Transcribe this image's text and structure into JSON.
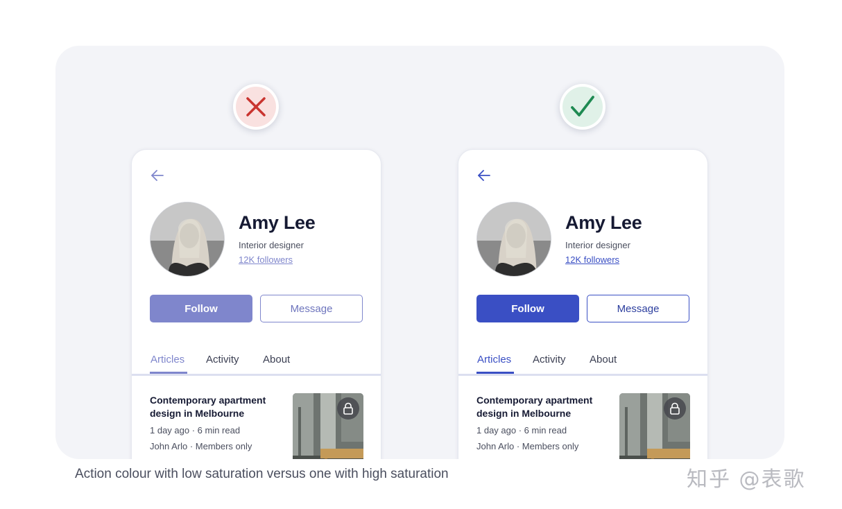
{
  "caption": "Action colour with low saturation versus one with high saturation",
  "watermark": "知乎 @表歌",
  "examples": [
    {
      "verdict": "incorrect",
      "verdict_icon": "x-icon",
      "accent": "#7f86cc",
      "profile": {
        "name": "Amy Lee",
        "role": "Interior designer",
        "followers": "12K followers"
      },
      "buttons": {
        "follow": "Follow",
        "message": "Message"
      },
      "tabs": [
        "Articles",
        "Activity",
        "About"
      ],
      "active_tab": "Articles",
      "article": {
        "title": "Contemporary apartment design in Melbourne",
        "meta": "1 day ago · 6 min read",
        "author": "John Arlo · Members only"
      }
    },
    {
      "verdict": "correct",
      "verdict_icon": "check-icon",
      "accent": "#3a4fc4",
      "profile": {
        "name": "Amy Lee",
        "role": "Interior designer",
        "followers": "12K followers"
      },
      "buttons": {
        "follow": "Follow",
        "message": "Message"
      },
      "tabs": [
        "Articles",
        "Activity",
        "About"
      ],
      "active_tab": "Articles",
      "article": {
        "title": "Contemporary apartment design in Melbourne",
        "meta": "1 day ago · 6 min read",
        "author": "John Arlo · Members only"
      }
    }
  ],
  "colors": {
    "x_mark": "#c9342f",
    "check_mark": "#1e8a52"
  }
}
